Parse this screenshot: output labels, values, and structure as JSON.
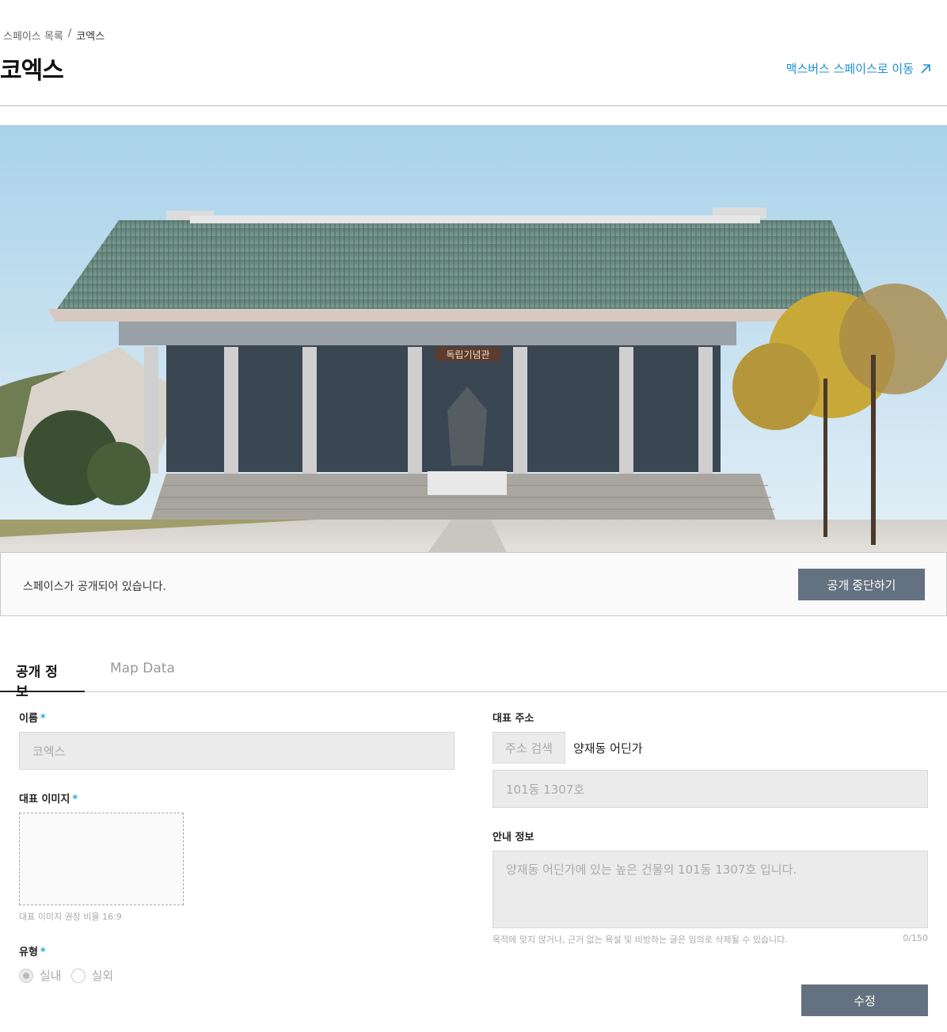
{
  "breadcrumb": {
    "parent": "스페이스 목록",
    "separator": "/",
    "current": "코엑스"
  },
  "header": {
    "title": "코엑스",
    "metaverse_link": "맥스버스 스페이스로 이동",
    "link_icon": "arrow-up-right-icon"
  },
  "hero": {
    "sign_text": "독립기념관"
  },
  "publish": {
    "status_text": "스페이스가 공개되어 있습니다.",
    "stop_button": "공개 중단하기"
  },
  "tabs": [
    {
      "label": "공개 정보",
      "active": true
    },
    {
      "label": "Map Data",
      "active": false
    }
  ],
  "form": {
    "name": {
      "label": "이름",
      "required_mark": "*",
      "value": "코엑스"
    },
    "image": {
      "label": "대표 이미지",
      "required_mark": "*",
      "hint": "대표 이미지 권장 비율 16:9"
    },
    "type": {
      "label": "유형",
      "required_mark": "*",
      "options": [
        {
          "label": "실내",
          "checked": true
        },
        {
          "label": "실외",
          "checked": false
        }
      ]
    },
    "address": {
      "label": "대표 주소",
      "search_button": "주소 검색",
      "value": "양재동 어딘가",
      "detail": "101동 1307호"
    },
    "guide": {
      "label": "안내 정보",
      "value": "양재동 어딘가에 있는 높은 건물의 101동 1307호 입니다.",
      "notice": "목적에 맞지 않거나, 근거 없는 욕설 및 비방하는 글은 임의로 삭제될 수 있습니다.",
      "counter": "0/150"
    },
    "edit_button": "수정"
  },
  "colors": {
    "accent": "#1b8fd6",
    "required": "#18b0d6",
    "button": "#647180"
  }
}
